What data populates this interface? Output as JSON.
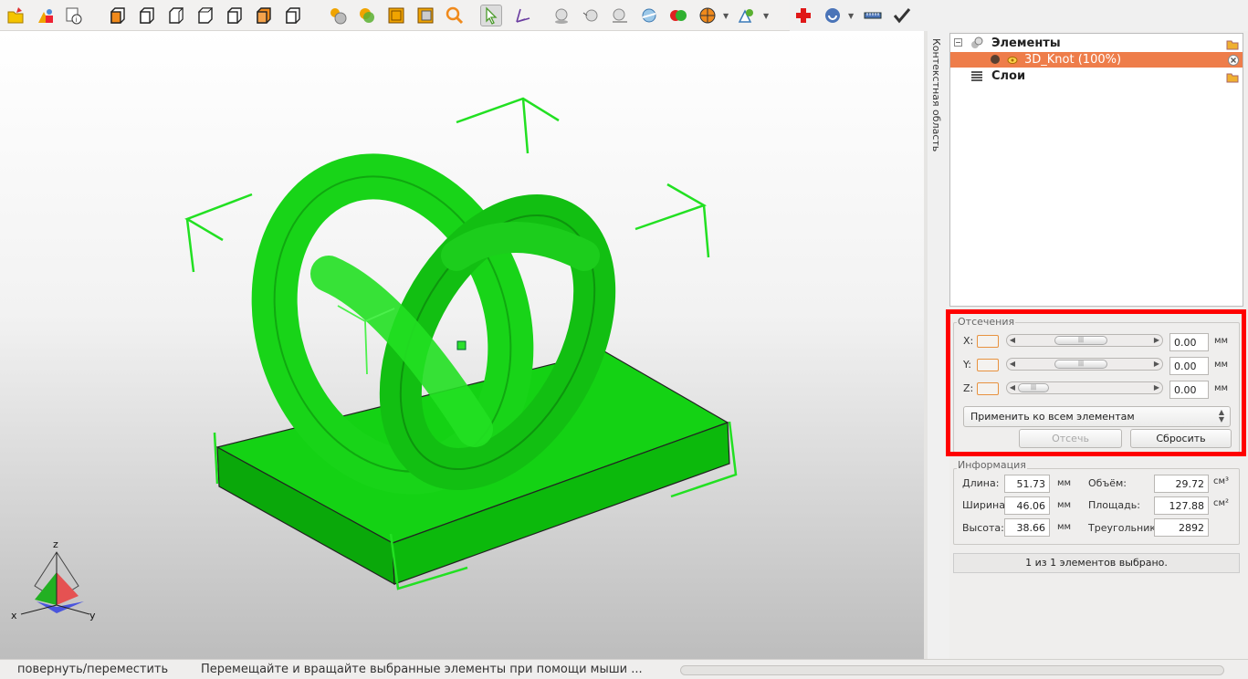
{
  "toolbar": {
    "icons": [
      "open-file-icon",
      "add-shapes-icon",
      "object-info-icon",
      "view-front-icon",
      "view-back-icon",
      "view-left-icon",
      "view-right-icon",
      "view-top-icon",
      "view-bottom-icon",
      "view-iso-icon",
      "render-shaded-icon",
      "render-colored-icon",
      "wireframe-icon",
      "texture-icon",
      "zoom-icon",
      "select-pointer-icon",
      "move-axis-icon",
      "scale-icon",
      "rotate-icon",
      "measure-icon",
      "mirror-icon",
      "color-icon",
      "sphere-map-icon",
      "analyze-icon",
      "repair-icon",
      "export-icon",
      "ruler-icon",
      "checkmark-icon"
    ]
  },
  "context_tab": "Контекстная область",
  "tree": {
    "root_label": "Элементы",
    "item_label": "3D_Knot (100%)",
    "layers_label": "Слои"
  },
  "cut": {
    "title": "Отсечения",
    "axes": [
      {
        "label": "X:",
        "value": "0.00",
        "unit": "мм",
        "position": 0.45
      },
      {
        "label": "Y:",
        "value": "0.00",
        "unit": "мм",
        "position": 0.45
      },
      {
        "label": "Z:",
        "value": "0.00",
        "unit": "мм",
        "position": 0.0
      }
    ],
    "apply_option": "Применить ко всем элементам",
    "cut_button": "Отсечь",
    "reset_button": "Сбросить"
  },
  "info": {
    "title": "Информация",
    "length_label": "Длина:",
    "length_value": "51.73",
    "length_unit": "мм",
    "width_label": "Ширина:",
    "width_value": "46.06",
    "width_unit": "мм",
    "height_label": "Высота:",
    "height_value": "38.66",
    "height_unit": "мм",
    "volume_label": "Объём:",
    "volume_value": "29.72",
    "volume_unit": "см³",
    "area_label": "Площадь:",
    "area_value": "127.88",
    "area_unit": "см²",
    "triangles_label": "Треугольники",
    "triangles_value": "2892"
  },
  "selection_status": "1 из 1 элементов выбрано.",
  "statusbar": {
    "mode": "повернуть/переместить",
    "hint": "Перемещайте и вращайте выбранные элементы при помощи мыши ..."
  },
  "axes_gizmo": {
    "x": "x",
    "y": "y",
    "z": "z"
  },
  "colors": {
    "model": "#15d515",
    "selection": "#ee7d4a",
    "highlight": "#ff0000",
    "bracket": "#22e022"
  }
}
